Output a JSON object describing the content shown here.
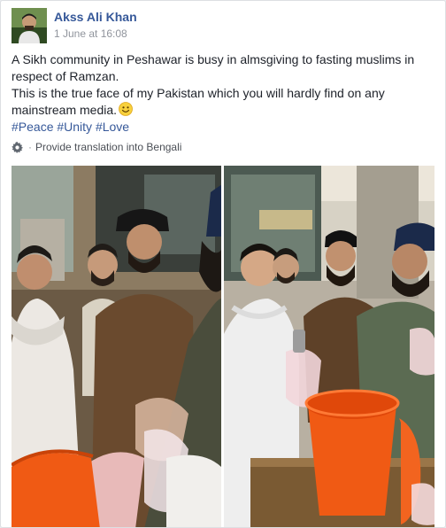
{
  "post": {
    "author": "Akss Ali Khan",
    "timestamp": "1 June at 16:08",
    "text_line1": "A Sikh community in Peshawar is busy in almsgiving to fasting muslims in respect of Ramzan.",
    "text_line2": "This is the true face of my Pakistan which you will hardly find on any mainstream media.",
    "emoji": "smiley-face-icon",
    "hashtags": [
      "#Peace",
      "#Unity",
      "#Love"
    ],
    "translation_link": "Provide translation into Bengali"
  },
  "photos": [
    {
      "name": "photo-left",
      "subject": "Sikh men pouring drink into plastic bags for a young man"
    },
    {
      "name": "photo-right",
      "subject": "Sikh men filling a bag from an orange bucket for a boy"
    }
  ],
  "colors": {
    "link": "#365899",
    "text": "#1d2129",
    "meta": "#90949c",
    "bucket": "#f05a14",
    "turban": "#1b2a4a"
  }
}
